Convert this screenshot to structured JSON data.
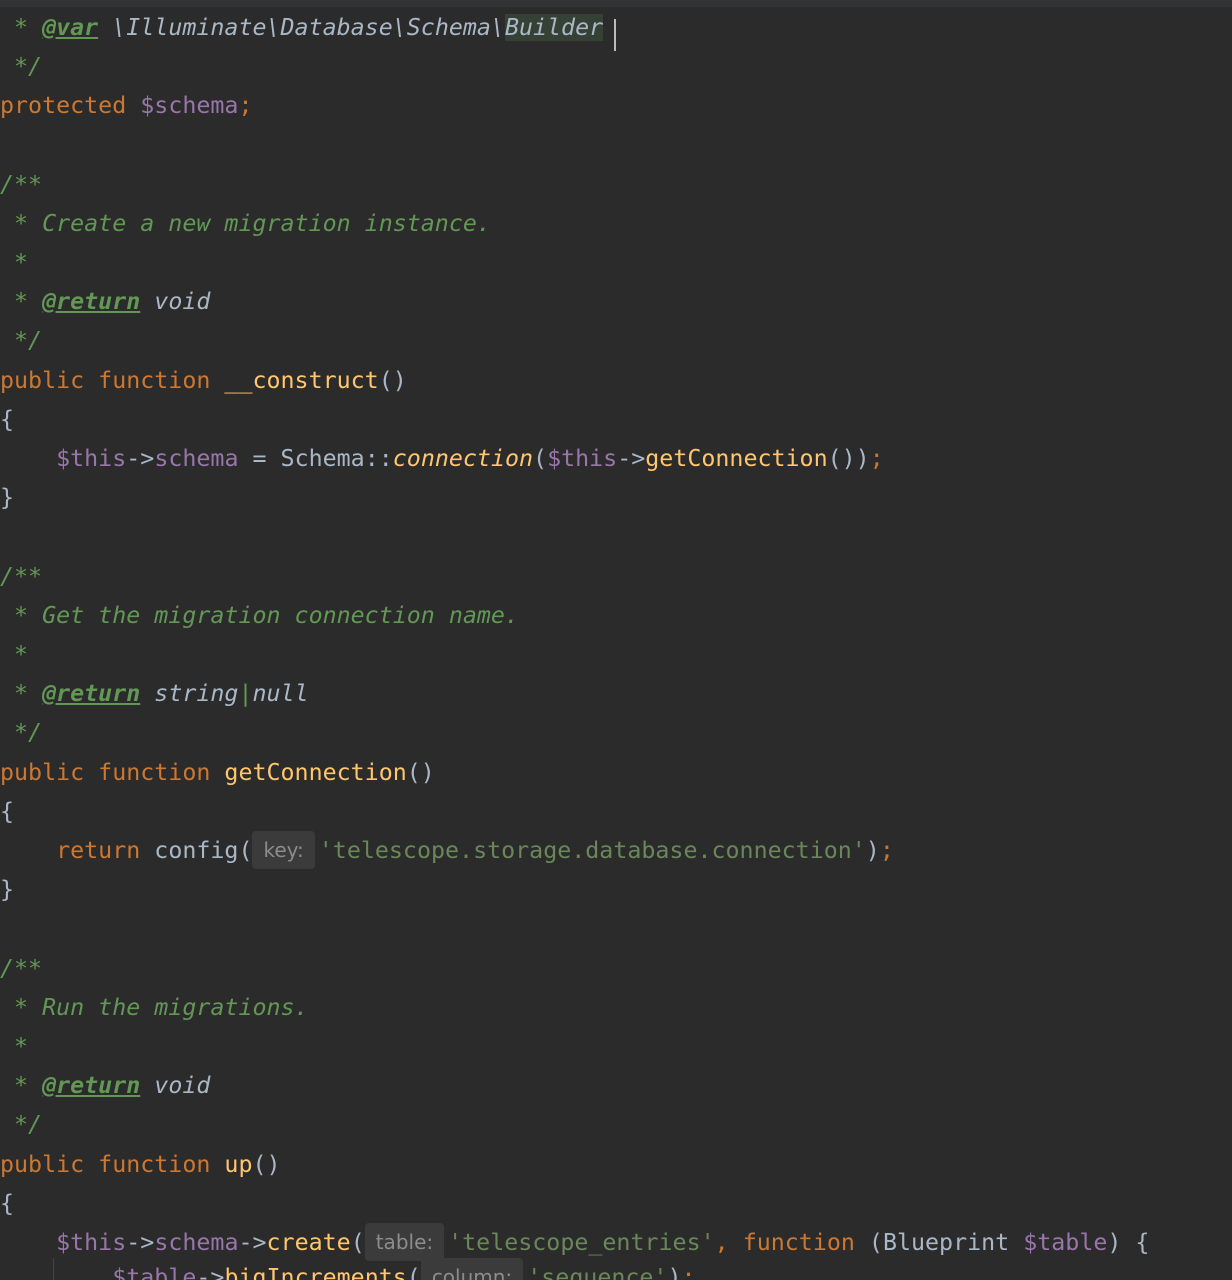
{
  "code": {
    "l1": {
      "star": " * ",
      "tag": "@var",
      "sp": " ",
      "type_a": "\\Illuminate\\Database\\Schema\\",
      "type_b": "Builder"
    },
    "l2": {
      "text": " */"
    },
    "l3": {
      "kw": "protected",
      "sp": " ",
      "var": "$schema",
      "semi": ";"
    },
    "l5": {
      "text": "/**"
    },
    "l6": {
      "text": " * Create a new migration instance."
    },
    "l7": {
      "text": " *"
    },
    "l8": {
      "star": " * ",
      "tag": "@return",
      "type": " void"
    },
    "l9": {
      "text": " */"
    },
    "l10": {
      "kw": "public function",
      "sp": " ",
      "fn": "__construct",
      "parens": "()"
    },
    "l11": {
      "text": "{"
    },
    "l12": {
      "indent": "    ",
      "this1": "$this",
      "arrow1": "->",
      "prop": "schema",
      "mid": " = Schema::",
      "method": "connection",
      "open": "(",
      "this2": "$this",
      "arrow2": "->",
      "call": "getConnection",
      "close": "())",
      "semi": ";"
    },
    "l13": {
      "text": "}"
    },
    "l15": {
      "text": "/**"
    },
    "l16": {
      "text": " * Get the migration connection name."
    },
    "l17": {
      "text": " *"
    },
    "l18": {
      "star": " * ",
      "tag": "@return",
      "type1": " string",
      "pipe": "|",
      "type2": "null"
    },
    "l19": {
      "text": " */"
    },
    "l20": {
      "kw": "public function",
      "sp": " ",
      "fn": "getConnection",
      "parens": "()"
    },
    "l21": {
      "text": "{"
    },
    "l22": {
      "indent": "    ",
      "kw": "return",
      "sp": " ",
      "call": "config(",
      "hint": "key:",
      "str": "'telescope.storage.database.connection'",
      "close": ")",
      "semi": ";"
    },
    "l23": {
      "text": "}"
    },
    "l25": {
      "text": "/**"
    },
    "l26": {
      "text": " * Run the migrations."
    },
    "l27": {
      "text": " *"
    },
    "l28": {
      "star": " * ",
      "tag": "@return",
      "type": " void"
    },
    "l29": {
      "text": " */"
    },
    "l30": {
      "kw": "public function",
      "sp": " ",
      "fn": "up",
      "parens": "()"
    },
    "l31": {
      "text": "{"
    },
    "l32": {
      "indent": "    ",
      "this": "$this",
      "arrow1": "->",
      "prop": "schema",
      "arrow2": "->",
      "method": "create",
      "open": "(",
      "hint": "table:",
      "str": "'telescope_entries'",
      "comma": ", ",
      "kw": "function",
      "params_a": " (Blueprint ",
      "param_var": "$table",
      "params_b": ") {"
    },
    "l33": {
      "indent": "        ",
      "var": "$table",
      "arrow": "->",
      "method": "bigIncrements",
      "open": "(",
      "hint": "column:",
      "str": "'sequence'",
      "close": ")",
      "semi": ";"
    }
  }
}
